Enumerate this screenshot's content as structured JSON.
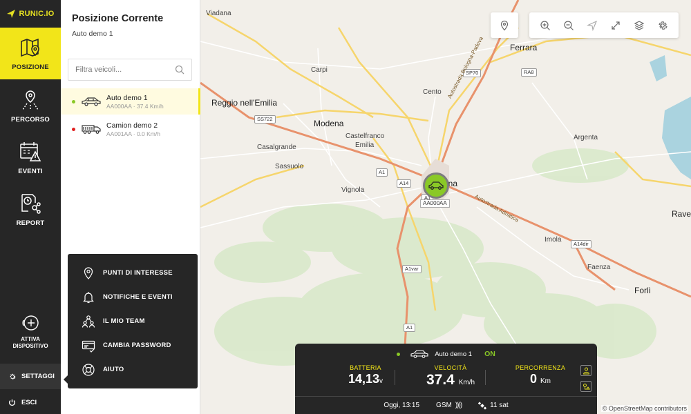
{
  "brand": {
    "logo_text": "RUNIC.IO",
    "accent": "#f2e519",
    "online_color": "#8ac926",
    "offline_color": "#e02020"
  },
  "nav": {
    "items": [
      {
        "label": "POSIZIONE",
        "icon": "map-pin-icon",
        "active": true
      },
      {
        "label": "PERCORSO",
        "icon": "route-icon"
      },
      {
        "label": "EVENTI",
        "icon": "calendar-alert-icon"
      },
      {
        "label": "REPORT",
        "icon": "report-clock-icon"
      }
    ],
    "activate": {
      "line1": "ATTIVA",
      "line2": "DISPOSITIVO",
      "icon": "plus-circle-icon"
    },
    "settings": {
      "label": "SETTAGGI",
      "icon": "gear-icon"
    },
    "exit": {
      "label": "ESCI",
      "icon": "power-icon"
    }
  },
  "panel": {
    "title": "Posizione Corrente",
    "subtitle": "Auto demo 1",
    "filter_placeholder": "Filtra veicoli...",
    "vehicles": [
      {
        "name": "Auto demo 1",
        "meta": "AA000AA · 37.4 Km/h",
        "status": "online",
        "icon": "car-icon"
      },
      {
        "name": "Camion demo 2",
        "meta": "AA001AA · 0.0 Km/h",
        "status": "offline",
        "icon": "truck-icon"
      }
    ]
  },
  "settings_menu": [
    {
      "label": "PUNTI DI INTERESSE",
      "icon": "poi-pin-icon"
    },
    {
      "label": "NOTIFICHE E EVENTI",
      "icon": "bell-icon"
    },
    {
      "label": "IL MIO TEAM",
      "icon": "team-icon"
    },
    {
      "label": "CAMBIA PASSWORD",
      "icon": "password-card-icon"
    },
    {
      "label": "AIUTO",
      "icon": "lifebuoy-icon"
    }
  ],
  "map": {
    "cities": [
      {
        "name": "Viadana",
        "big": false
      },
      {
        "name": "Ferrara",
        "big": true
      },
      {
        "name": "Carpi",
        "big": false
      },
      {
        "name": "Cento",
        "big": false
      },
      {
        "name": "Reggio nell'Emilia",
        "big": true
      },
      {
        "name": "Modena",
        "big": true
      },
      {
        "name": "Castelfranco",
        "big": false
      },
      {
        "name": "Emilia",
        "big": false
      },
      {
        "name": "Casalgrande",
        "big": false
      },
      {
        "name": "Sassuolo",
        "big": false
      },
      {
        "name": "Vignola",
        "big": false
      },
      {
        "name": "Argenta",
        "big": false
      },
      {
        "name": "Imola",
        "big": false
      },
      {
        "name": "Faenza",
        "big": false
      },
      {
        "name": "Forlì",
        "big": true
      },
      {
        "name": "Rave",
        "big": true
      },
      {
        "name": "gna",
        "big": true
      }
    ],
    "shields": [
      "SP70",
      "RA8",
      "SS722",
      "A1",
      "A14",
      "A1",
      "A14dir",
      "A1var",
      "A1"
    ],
    "highway_labels": [
      "Autostrada Bologna-Padova",
      "Autostrada Adriatica"
    ],
    "marker_plate": "AA000AA",
    "attribution": "© OpenStreetMap contributors",
    "toolbar": [
      "locate-pin-icon",
      "zoom-in-icon",
      "zoom-out-icon",
      "navigate-arrow-icon",
      "fullscreen-icon",
      "layers-icon",
      "settings-gear-icon"
    ]
  },
  "card": {
    "vehicle": "Auto demo 1",
    "state": "ON",
    "battery": {
      "label": "BATTERIA",
      "value": "14,13",
      "unit": "v"
    },
    "speed": {
      "label": "VELOCITÀ",
      "value": "37.4",
      "unit": "Km/h"
    },
    "distance": {
      "label": "PERCORRENZA",
      "value": "0",
      "unit": "Km"
    },
    "time": "Oggi, 13:15",
    "gsm": "GSM",
    "gsm_signal": "))))",
    "sat": "11 sat"
  }
}
